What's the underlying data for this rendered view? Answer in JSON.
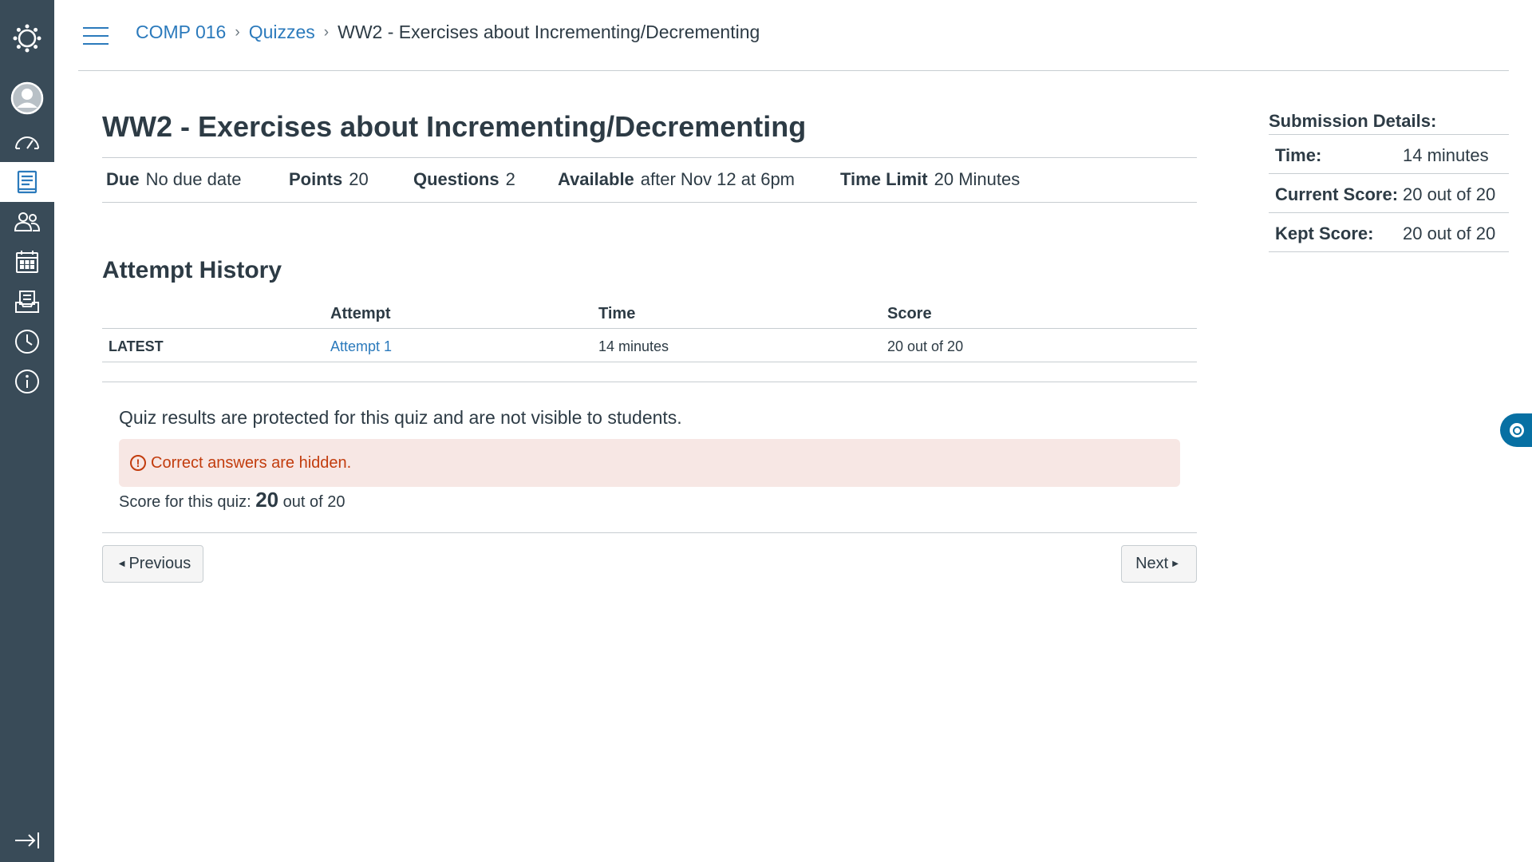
{
  "nav": {
    "items": [
      {
        "icon": "canvas-logo-icon"
      },
      {
        "icon": "account-icon"
      },
      {
        "icon": "dashboard-icon"
      },
      {
        "icon": "courses-icon",
        "active": true
      },
      {
        "icon": "groups-icon"
      },
      {
        "icon": "calendar-icon"
      },
      {
        "icon": "inbox-icon"
      },
      {
        "icon": "history-icon"
      },
      {
        "icon": "help-icon"
      }
    ],
    "collapse_icon": "collapse-nav-icon"
  },
  "breadcrumb": {
    "course": "COMP 016",
    "section": "Quizzes",
    "current": "WW2 - Exercises about Incrementing/Decrementing"
  },
  "quiz": {
    "title": "WW2 - Exercises about Incrementing/Decrementing",
    "meta": {
      "due_label": "Due",
      "due_value": "No due date",
      "points_label": "Points",
      "points_value": "20",
      "questions_label": "Questions",
      "questions_value": "2",
      "available_label": "Available",
      "available_value": "after Nov 12 at 6pm",
      "time_limit_label": "Time Limit",
      "time_limit_value": "20 Minutes"
    }
  },
  "attempt_history": {
    "title": "Attempt History",
    "columns": [
      "Attempt",
      "Time",
      "Score"
    ],
    "rows": [
      {
        "label": "LATEST",
        "attempt": "Attempt 1",
        "time": "14 minutes",
        "score": "20 out of 20"
      }
    ]
  },
  "results": {
    "protected_message": "Quiz results are protected for this quiz and are not visible to students.",
    "alert": "Correct answers are hidden.",
    "score_prefix": "Score for this quiz:",
    "score_value": "20",
    "score_suffix": "out of 20"
  },
  "pagination": {
    "previous": "Previous",
    "next": "Next"
  },
  "submission": {
    "title": "Submission Details:",
    "rows": [
      {
        "label": "Time:",
        "value": "14 minutes"
      },
      {
        "label": "Current Score:",
        "value": "20 out of 20"
      },
      {
        "label": "Kept Score:",
        "value": "20 out of 20"
      }
    ]
  },
  "colors": {
    "nav_bg": "#394b58",
    "link": "#2b7abc",
    "alert_bg": "#f7e7e4",
    "alert_text": "#c23c0d",
    "text": "#2d3b45"
  }
}
